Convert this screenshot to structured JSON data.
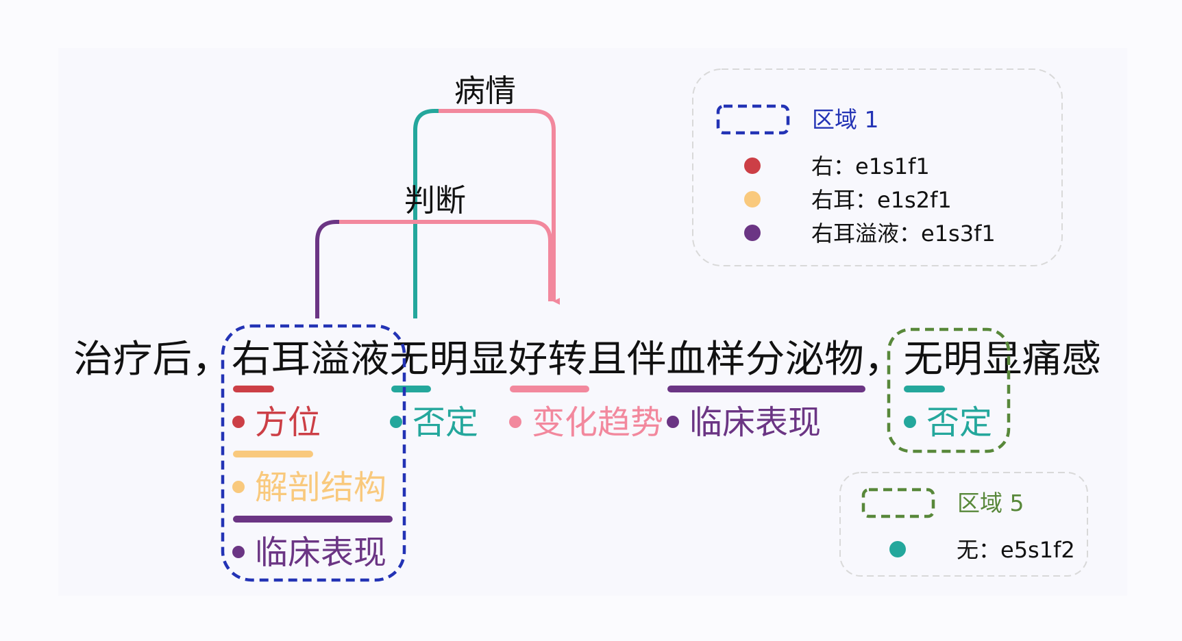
{
  "sentence": [
    {
      "text": "治疗后，",
      "color": "#111111"
    },
    {
      "text": "右耳溢液",
      "color": "#111111"
    },
    {
      "text": "无明显好转且伴血样分泌物，",
      "color": "#111111"
    },
    {
      "text": "无明显痛感",
      "color": "#111111"
    }
  ],
  "annotations": [
    {
      "label": "方位",
      "color": "#cc3f46"
    },
    {
      "label": "解剖结构",
      "color": "#f9c97d"
    },
    {
      "label": "临床表现",
      "color": "#6b3584"
    },
    {
      "label": "否定",
      "color": "#24a79c"
    },
    {
      "label": "变化趋势",
      "color": "#f2889d"
    },
    {
      "label": "临床表现",
      "color": "#6b3584"
    },
    {
      "label": "否定",
      "color": "#24a79c"
    }
  ],
  "relations": [
    {
      "label": "病情",
      "from_color": "#24a79c",
      "to_color": "#f2889d"
    },
    {
      "label": "判断",
      "from_color": "#6b3584",
      "to_color": "#f2889d"
    }
  ],
  "legends": [
    {
      "title": "区域 1",
      "region_color": "#2333b5",
      "items": [
        {
          "text": "右：e1s1f1",
          "color": "#cc3f46"
        },
        {
          "text": "右耳：e1s2f1",
          "color": "#f9c97d"
        },
        {
          "text": "右耳溢液：e1s3f1",
          "color": "#6b3584"
        }
      ]
    },
    {
      "title": "区域 5",
      "region_color": "#58883a",
      "items": [
        {
          "text": "无：e5s1f2",
          "color": "#24a79c"
        }
      ]
    }
  ]
}
